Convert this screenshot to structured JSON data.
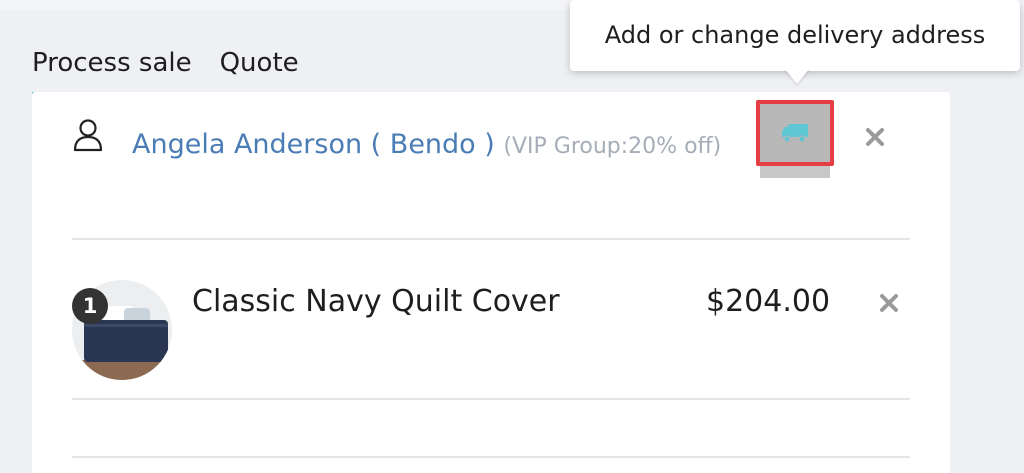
{
  "tabs": [
    {
      "label": "Process sale",
      "active": true
    },
    {
      "label": "Quote",
      "active": false
    }
  ],
  "customer": {
    "name": "Angela Anderson ( Bendo )",
    "group": "(VIP Group:20% off)",
    "icon": "user-icon"
  },
  "delivery": {
    "icon": "truck-icon",
    "tooltip": "Add or change delivery address"
  },
  "cart": {
    "items": [
      {
        "quantity": "1",
        "name": "Classic Navy Quilt Cover",
        "price": "$204.00",
        "image": "quilt-cover-thumbnail"
      }
    ]
  },
  "colors": {
    "accent": "#59c0cb",
    "customer_name": "#4a7cb5",
    "highlight_border": "#e53e43"
  }
}
